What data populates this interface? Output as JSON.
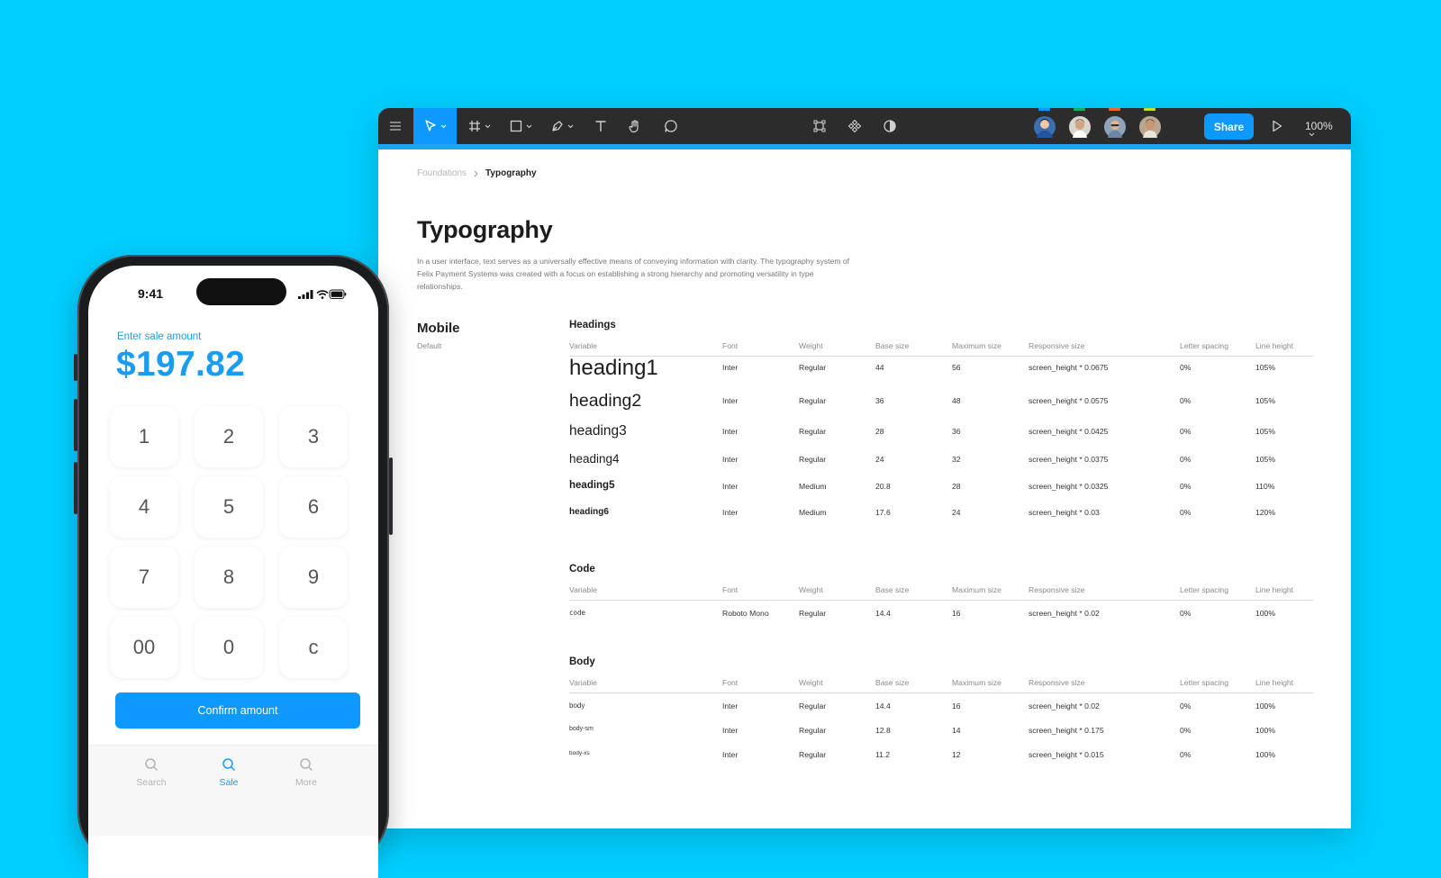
{
  "toolbar": {
    "share_label": "Share",
    "zoom": "100%",
    "icons": [
      "menu-icon",
      "move-tool-icon",
      "frame-tool-icon",
      "shape-tool-icon",
      "pen-tool-icon",
      "text-tool-icon",
      "hand-tool-icon",
      "comment-tool-icon",
      "components-icon",
      "assets-icon",
      "contrast-icon",
      "present-icon",
      "chevron-down-icon"
    ],
    "avatar_colors": [
      "#0d99ff",
      "#14ae5c",
      "#e86b2a",
      "#c7e021"
    ],
    "accent_color": "#0d99ff"
  },
  "document": {
    "breadcrumb": [
      "Foundations",
      "Typography"
    ],
    "title": "Typography",
    "description": "In a user interface, text serves as a universally effective means of conveying information with clarity. The typography system of Felix Payment Systems was created with a focus on establishing a strong hierarchy and promoting versatility in type relationships.",
    "section": "Mobile",
    "section_sub": "Default",
    "columns": [
      "Variable",
      "Font",
      "Weight",
      "Base size",
      "Maximum size",
      "Responsive size",
      "Letter spacing",
      "Line height"
    ],
    "tables": [
      {
        "title": "Headings",
        "rows": [
          [
            "heading1",
            "Inter",
            "Regular",
            "44",
            "56",
            "screen_height * 0.0675",
            "0%",
            "105%"
          ],
          [
            "heading2",
            "Inter",
            "Regular",
            "36",
            "48",
            "screen_height * 0.0575",
            "0%",
            "105%"
          ],
          [
            "heading3",
            "Inter",
            "Regular",
            "28",
            "36",
            "screen_height * 0.0425",
            "0%",
            "105%"
          ],
          [
            "heading4",
            "Inter",
            "Regular",
            "24",
            "32",
            "screen_height * 0.0375",
            "0%",
            "105%"
          ],
          [
            "heading5",
            "Inter",
            "Medium",
            "20.8",
            "28",
            "screen_height * 0.0325",
            "0%",
            "110%"
          ],
          [
            "heading6",
            "Inter",
            "Medium",
            "17.6",
            "24",
            "screen_height * 0.03",
            "0%",
            "120%"
          ]
        ]
      },
      {
        "title": "Code",
        "rows": [
          [
            "code",
            "Roboto Mono",
            "Regular",
            "14.4",
            "16",
            "screen_height * 0.02",
            "0%",
            "100%"
          ]
        ]
      },
      {
        "title": "Body",
        "rows": [
          [
            "body",
            "Inter",
            "Regular",
            "14.4",
            "16",
            "screen_height * 0.02",
            "0%",
            "100%"
          ],
          [
            "body-sm",
            "Inter",
            "Regular",
            "12.8",
            "14",
            "screen_height * 0.175",
            "0%",
            "100%"
          ],
          [
            "body-xs",
            "Inter",
            "Regular",
            "11.2",
            "12",
            "screen_height * 0.015",
            "0%",
            "100%"
          ]
        ]
      }
    ]
  },
  "phone": {
    "time": "9:41",
    "sale_label": "Enter sale amount",
    "amount": "$197.82",
    "keypad": [
      "1",
      "2",
      "3",
      "4",
      "5",
      "6",
      "7",
      "8",
      "9",
      "00",
      "0",
      "c"
    ],
    "confirm_label": "Confirm amount",
    "tabs": [
      {
        "label": "Search",
        "active": false
      },
      {
        "label": "Sale",
        "active": true
      },
      {
        "label": "More",
        "active": false
      }
    ],
    "accent_color": "#1a9cf0"
  }
}
